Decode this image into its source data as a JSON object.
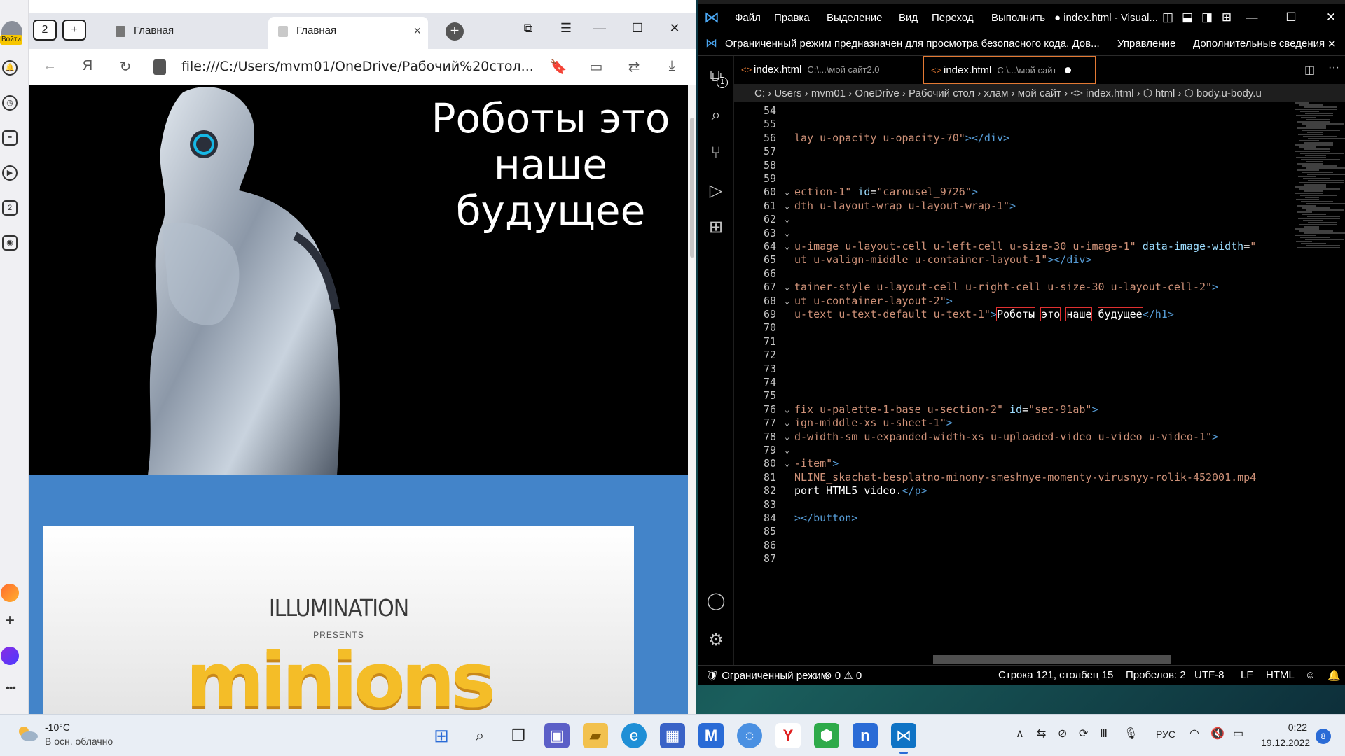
{
  "browser": {
    "sidebar": {
      "login_label": "Войти",
      "collections_badge": "2"
    },
    "tabs": [
      {
        "label": "Главная",
        "active": false
      },
      {
        "label": "Главная",
        "active": true
      }
    ],
    "tabs_counter": "2",
    "address": "file:///C:/Users/mvm01/OneDrive/Рабочий%20стол...",
    "page": {
      "hero_title": "Роботы это наше будущее",
      "video_brand": "ILLUMINATION",
      "video_presents": "PRESENTS",
      "video_title": "minions"
    }
  },
  "vscode": {
    "title_menu": [
      "Файл",
      "Правка",
      "Выделение",
      "Вид",
      "Переход",
      "Выполнить"
    ],
    "window_title": "● index.html - Visual...",
    "banner": {
      "text": "Ограниченный режим предназначен для просмотра безопасного кода. Дов...",
      "manage": "Управление",
      "details": "Дополнительные сведения"
    },
    "explorer_badge": "1",
    "tabs": [
      {
        "name": "index.html",
        "path": "C:\\...\\мой сайт2.0",
        "active": false
      },
      {
        "name": "index.html",
        "path": "C:\\...\\мой сайт",
        "active": true,
        "modified": true
      }
    ],
    "breadcrumb": "C: › Users › mvm01 › OneDrive › Рабочий стол › хлам › мой сайт › <> index.html › ⬡ html › ⬡ body.u-body.u",
    "lines": [
      {
        "n": "54",
        "fold": "",
        "code": []
      },
      {
        "n": "55",
        "fold": "",
        "code": []
      },
      {
        "n": "56",
        "fold": "",
        "code": [
          [
            "c-str",
            "lay u-opacity u-opacity-70\""
          ],
          [
            "c-tag",
            "></div>"
          ]
        ]
      },
      {
        "n": "57",
        "fold": "",
        "code": []
      },
      {
        "n": "58",
        "fold": "",
        "code": []
      },
      {
        "n": "59",
        "fold": "",
        "code": []
      },
      {
        "n": "60",
        "fold": "v",
        "code": [
          [
            "c-str",
            "ection-1\" "
          ],
          [
            "c-attr",
            "id"
          ],
          [
            "c-txt",
            "="
          ],
          [
            "c-str",
            "\"carousel_9726\""
          ],
          [
            "c-tag",
            ">"
          ]
        ]
      },
      {
        "n": "61",
        "fold": "v",
        "code": [
          [
            "c-str",
            "dth u-layout-wrap u-layout-wrap-1\""
          ],
          [
            "c-tag",
            ">"
          ]
        ]
      },
      {
        "n": "62",
        "fold": "v",
        "code": []
      },
      {
        "n": "63",
        "fold": "v",
        "code": []
      },
      {
        "n": "64",
        "fold": "v",
        "code": [
          [
            "c-str",
            "u-image u-layout-cell u-left-cell u-size-30 u-image-1\" "
          ],
          [
            "c-attr",
            "data-image-width"
          ],
          [
            "c-txt",
            "="
          ],
          [
            "c-str",
            "\""
          ]
        ]
      },
      {
        "n": "65",
        "fold": "",
        "code": [
          [
            "c-str",
            "ut u-valign-middle u-container-layout-1\""
          ],
          [
            "c-tag",
            "></div>"
          ]
        ]
      },
      {
        "n": "66",
        "fold": "",
        "code": []
      },
      {
        "n": "67",
        "fold": "v",
        "code": [
          [
            "c-str",
            "tainer-style u-layout-cell u-right-cell u-size-30 u-layout-cell-2\""
          ],
          [
            "c-tag",
            ">"
          ]
        ]
      },
      {
        "n": "68",
        "fold": "v",
        "code": [
          [
            "c-str",
            "ut u-container-layout-2\""
          ],
          [
            "c-tag",
            ">"
          ]
        ]
      },
      {
        "n": "69",
        "fold": "",
        "code": [
          [
            "c-str",
            "u-text u-text-default u-text-1\""
          ],
          [
            "c-tag",
            ">"
          ],
          [
            "boxed",
            "Роботы"
          ],
          [
            "c-txt",
            " "
          ],
          [
            "boxed",
            "это"
          ],
          [
            "c-txt",
            " "
          ],
          [
            "boxed",
            "наше"
          ],
          [
            "c-txt",
            " "
          ],
          [
            "boxed",
            "будущее"
          ],
          [
            "c-tag",
            "</h1>"
          ]
        ]
      },
      {
        "n": "70",
        "fold": "",
        "code": []
      },
      {
        "n": "71",
        "fold": "",
        "code": []
      },
      {
        "n": "72",
        "fold": "",
        "code": []
      },
      {
        "n": "73",
        "fold": "",
        "code": []
      },
      {
        "n": "74",
        "fold": "",
        "code": []
      },
      {
        "n": "75",
        "fold": "",
        "code": []
      },
      {
        "n": "76",
        "fold": "v",
        "code": [
          [
            "c-str",
            "fix u-palette-1-base u-section-2\" "
          ],
          [
            "c-attr",
            "id"
          ],
          [
            "c-txt",
            "="
          ],
          [
            "c-str",
            "\"sec-91ab\""
          ],
          [
            "c-tag",
            ">"
          ]
        ]
      },
      {
        "n": "77",
        "fold": "v",
        "code": [
          [
            "c-str",
            "ign-middle-xs u-sheet-1\""
          ],
          [
            "c-tag",
            ">"
          ]
        ]
      },
      {
        "n": "78",
        "fold": "v",
        "code": [
          [
            "c-str",
            "d-width-sm u-expanded-width-xs u-uploaded-video u-video u-video-1\""
          ],
          [
            "c-tag",
            ">"
          ]
        ]
      },
      {
        "n": "79",
        "fold": "v",
        "code": []
      },
      {
        "n": "80",
        "fold": "v",
        "code": [
          [
            "c-str",
            "-item\""
          ],
          [
            "c-tag",
            ">"
          ]
        ]
      },
      {
        "n": "81",
        "fold": "",
        "code": [
          [
            "c-url",
            "NLINE_skachat-besplatno-minony-smeshnye-momenty-virusnyy-rolik-452001.mp4"
          ]
        ]
      },
      {
        "n": "82",
        "fold": "",
        "code": [
          [
            "c-txt",
            "port HTML5 video."
          ],
          [
            "c-tag",
            "</p>"
          ]
        ]
      },
      {
        "n": "83",
        "fold": "",
        "code": []
      },
      {
        "n": "84",
        "fold": "",
        "code": [
          [
            "c-tag",
            "></button>"
          ]
        ]
      },
      {
        "n": "85",
        "fold": "",
        "code": []
      },
      {
        "n": "86",
        "fold": "",
        "code": []
      },
      {
        "n": "87",
        "fold": "",
        "code": []
      }
    ],
    "status": {
      "restricted": "Ограниченный режим",
      "problems": "⊗ 0 ⚠ 0",
      "position": "Строка 121, столбец 15",
      "spaces": "Пробелов: 2",
      "encoding": "UTF-8",
      "eol": "LF",
      "language": "HTML"
    }
  },
  "taskbar": {
    "temperature": "-10°C",
    "weather": "В осн. облачно",
    "language": "РУС",
    "time": "0:22",
    "date": "19.12.2022",
    "notifications": "8"
  },
  "colors": {
    "vscode_accent": "#e37933",
    "page_blue": "#4384c9",
    "minions_yellow": "#f4bd28"
  }
}
